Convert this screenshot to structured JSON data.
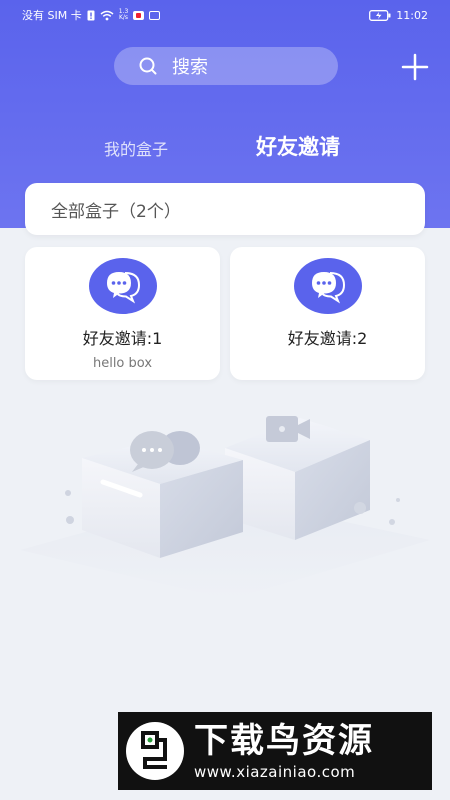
{
  "status_bar": {
    "carrier": "没有 SIM 卡",
    "net_speed_value": "1.3",
    "net_speed_unit": "K/s",
    "time": "11:02",
    "icons": [
      "sim-alert-icon",
      "wifi-icon",
      "notification-badge-icon",
      "gallery-icon",
      "battery-icon"
    ]
  },
  "header": {
    "search_label": "搜索",
    "tabs": [
      {
        "label": "我的盒子",
        "active": false
      },
      {
        "label": "好友邀请",
        "active": true
      }
    ],
    "accent_color": "#5a63ec"
  },
  "filter": {
    "label": "全部盒子（2个）"
  },
  "cards": [
    {
      "title": "好友邀请:1",
      "subtitle": "hello box",
      "icon": "chat-bubbles-icon"
    },
    {
      "title": "好友邀请:2",
      "subtitle": "",
      "icon": "chat-bubbles-icon"
    }
  ],
  "watermark": {
    "title": "下载鸟资源",
    "url": "www.xiazainiao.com"
  }
}
